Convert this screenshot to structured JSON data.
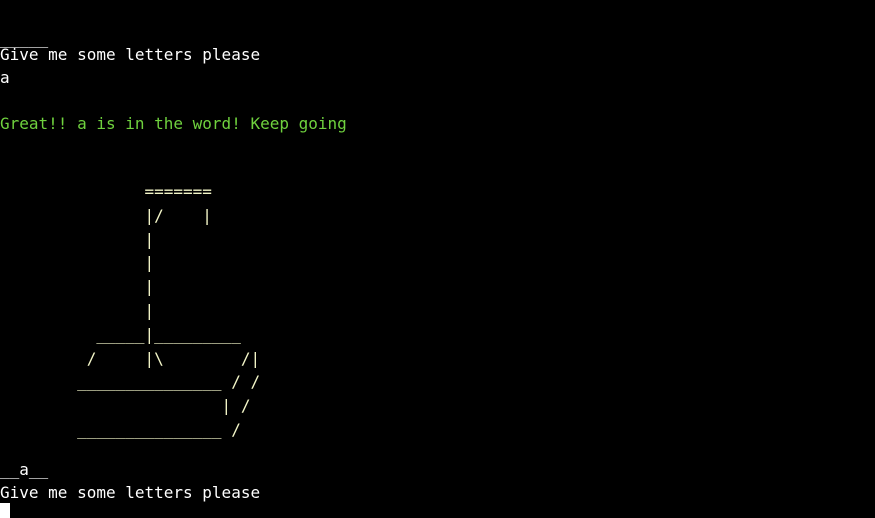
{
  "terminal": {
    "colors": {
      "background": "#000000",
      "text": "#ffffff",
      "success": "#6fd13e",
      "drawing": "#f3f6c8"
    },
    "lines": {
      "blanks_top": "_____",
      "prompt_1": "Give me some letters please",
      "input_1": "a",
      "feedback": "Great!! a is in the word! Keep going",
      "word_progress": "__a__",
      "prompt_2": "Give me some letters please"
    },
    "gallows_art": "               =======\n               |/    |\n               |\n               |\n               |\n               |\n          _____|_________\n         /     |\\        /|\n        _______________ / /\n                       | /\n        _______________ /"
  }
}
